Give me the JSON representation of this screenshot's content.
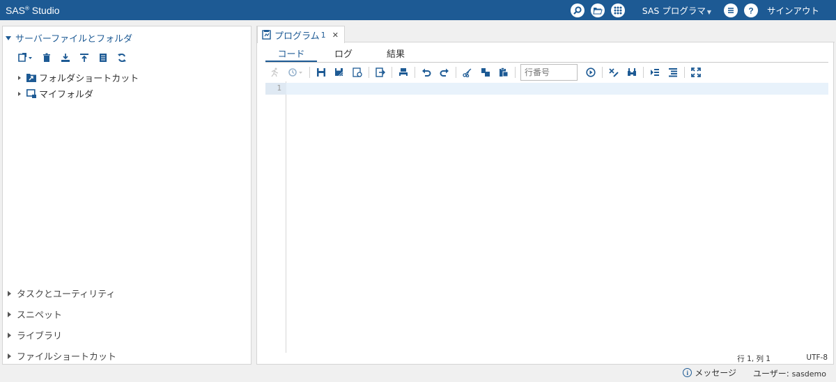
{
  "app": {
    "brand": "SAS",
    "brand_mark": "®",
    "brand_suffix": " Studio"
  },
  "topbar": {
    "program_menu": "SAS プログラマ",
    "sign_out": "サインアウト",
    "icons": [
      "search-icon",
      "open-folder-icon",
      "apps-grid-icon",
      "list-menu-icon",
      "help-icon"
    ]
  },
  "sidebar": {
    "section_title": "サーバーファイルとフォルダ",
    "tree": [
      {
        "label": "フォルダショートカット"
      },
      {
        "label": "マイフォルダ"
      }
    ],
    "lower_sections": [
      {
        "label": "タスクとユーティリティ"
      },
      {
        "label": "スニペット"
      },
      {
        "label": "ライブラリ"
      },
      {
        "label": "ファイルショートカット"
      }
    ]
  },
  "editor": {
    "tab_title": "プログラム",
    "tab_number": "1",
    "close_glyph": "✕",
    "subtabs": [
      "コード",
      "ログ",
      "結果"
    ],
    "line_number_placeholder": "行番号",
    "gutter_line": "1",
    "status_position": "行 1, 列 1",
    "status_encoding": "UTF-8"
  },
  "footer": {
    "messages_label": "メッセージ",
    "user_label": "ユーザー: ",
    "user_name": "sasdemo"
  },
  "colors": {
    "accent": "#1d5a94",
    "current_line": "#e8f2fb"
  }
}
